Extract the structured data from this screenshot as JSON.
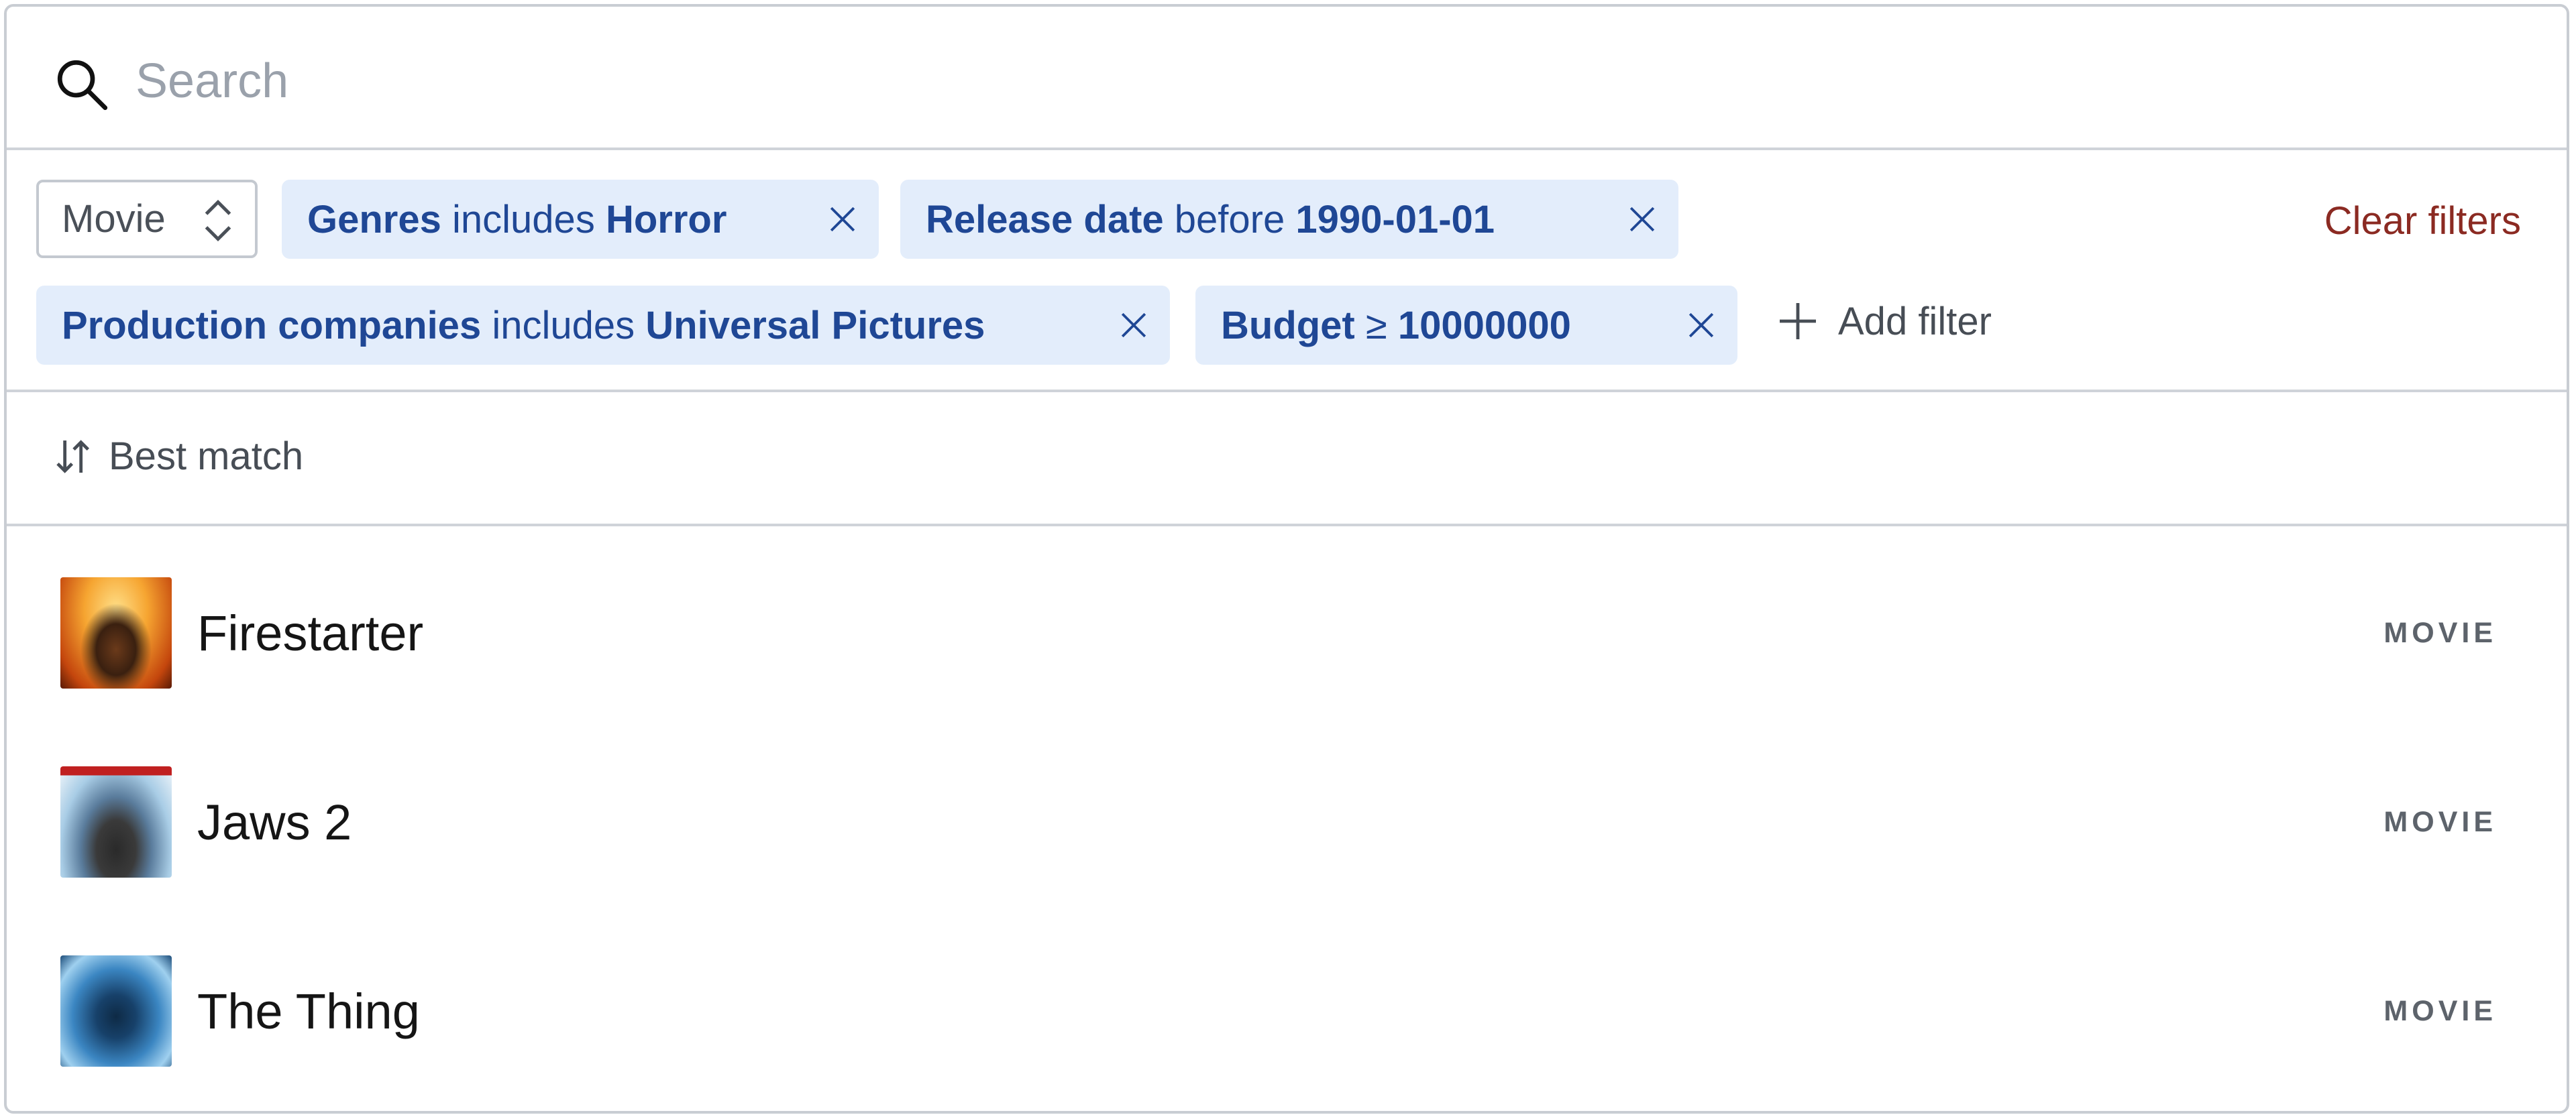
{
  "search": {
    "placeholder": "Search",
    "value": "",
    "icon": "search-icon"
  },
  "filters": {
    "type_select": {
      "selected": "Movie",
      "icon": "chevron-up-down-icon"
    },
    "chips": [
      {
        "field": "Genres",
        "operator": "includes",
        "value": "Horror"
      },
      {
        "field": "Release date",
        "operator": "before",
        "value": "1990-01-01"
      },
      {
        "field": "Production companies",
        "operator": "includes",
        "value": "Universal Pictures"
      },
      {
        "field": "Budget",
        "operator": "≥",
        "value": "10000000"
      }
    ],
    "add_filter_label": "Add filter",
    "clear_filters_label": "Clear filters"
  },
  "sort": {
    "label": "Best match",
    "icon": "sort-arrows-icon"
  },
  "results": [
    {
      "title": "Firestarter",
      "type": "MOVIE"
    },
    {
      "title": "Jaws 2",
      "type": "MOVIE"
    },
    {
      "title": "The Thing",
      "type": "MOVIE"
    }
  ],
  "colors": {
    "chip_bg": "#e3edfb",
    "chip_text": "#1f4795",
    "clear_filters": "#8b2a22",
    "border": "#c9cdd3"
  }
}
